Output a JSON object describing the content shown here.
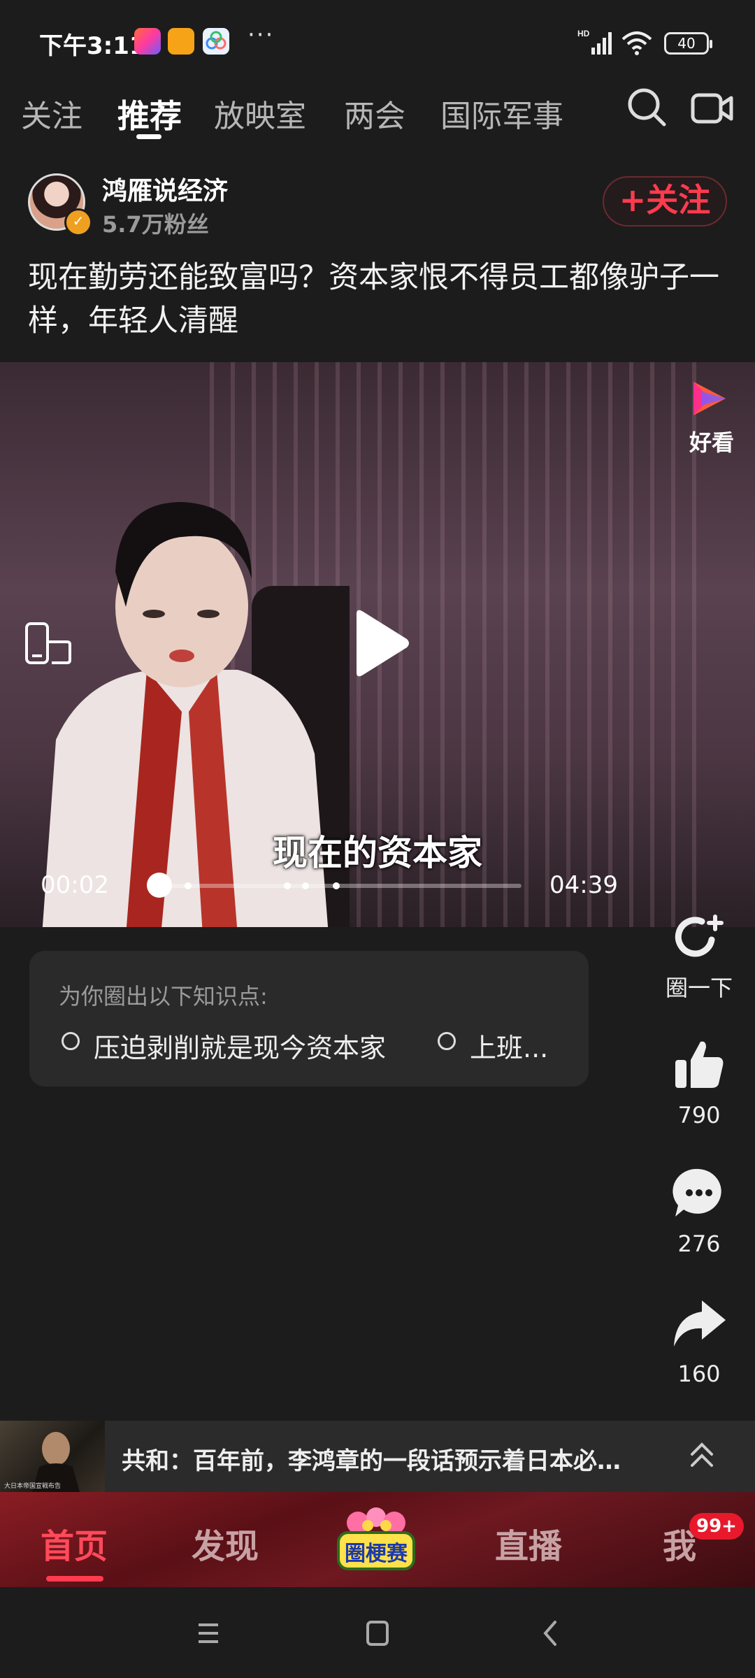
{
  "status_bar": {
    "time": "下午3:11",
    "more": "···",
    "battery": "40",
    "signal_label": "HD"
  },
  "top_tabs": [
    {
      "label": "关注",
      "active": false
    },
    {
      "label": "推荐",
      "active": true
    },
    {
      "label": "放映室",
      "active": false
    },
    {
      "label": "两会",
      "active": false
    },
    {
      "label": "国际军事",
      "active": false
    }
  ],
  "author": {
    "name": "鸿雁说经济",
    "fans": "5.7万粉丝",
    "follow_label": "+关注"
  },
  "video": {
    "title": "现在勤劳还能致富吗？资本家恨不得员工都像驴子一样，年轻人清醒",
    "subtitle": "现在的资本家",
    "current_time": "00:02",
    "total_time": "04:39",
    "progress": 0.007,
    "watermark": "好看"
  },
  "knowledge": {
    "heading": "为你圈出以下知识点:",
    "points": [
      "压迫剥削就是现今资本家",
      "上班..."
    ]
  },
  "actions": {
    "circle_label": "圈一下",
    "likes": "790",
    "comments": "276",
    "shares": "160"
  },
  "related": {
    "title": "共和：百年前，李鸿章的一段话预示着日本必…",
    "thumb_caption": "大日本帝国宣戦布告"
  },
  "bottom_nav": {
    "items": [
      {
        "label": "首页",
        "active": true
      },
      {
        "label": "发现",
        "active": false
      },
      {
        "label": "直播",
        "active": false
      },
      {
        "label": "我",
        "active": false
      }
    ],
    "center_badge": "圈梗赛",
    "me_badge": "99+"
  },
  "colors": {
    "accent": "#ff3b4e",
    "background": "#1c1c1c"
  }
}
